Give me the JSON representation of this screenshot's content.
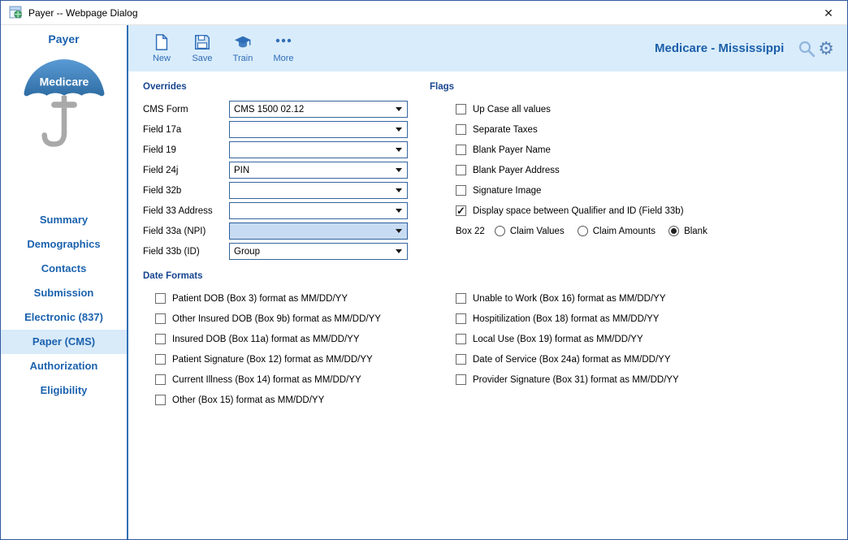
{
  "window": {
    "title": "Payer -- Webpage Dialog",
    "close_glyph": "✕"
  },
  "sidebar": {
    "title": "Payer",
    "logo_text": "Medicare",
    "items": [
      {
        "label": "Summary",
        "active": false
      },
      {
        "label": "Demographics",
        "active": false
      },
      {
        "label": "Contacts",
        "active": false
      },
      {
        "label": "Submission",
        "active": false
      },
      {
        "label": "Electronic (837)",
        "active": false
      },
      {
        "label": "Paper (CMS)",
        "active": true
      },
      {
        "label": "Authorization",
        "active": false
      },
      {
        "label": "Eligibility",
        "active": false
      }
    ]
  },
  "toolbar": {
    "buttons": [
      {
        "label": "New"
      },
      {
        "label": "Save"
      },
      {
        "label": "Train"
      },
      {
        "label": "More"
      }
    ],
    "context_title": "Medicare - Mississippi"
  },
  "sections": {
    "overrides": {
      "heading": "Overrides",
      "fields": [
        {
          "label": "CMS Form",
          "value": "CMS 1500 02.12",
          "focused": false
        },
        {
          "label": "Field 17a",
          "value": "",
          "focused": false
        },
        {
          "label": "Field 19",
          "value": "",
          "focused": false
        },
        {
          "label": "Field 24j",
          "value": "PIN",
          "focused": false
        },
        {
          "label": "Field 32b",
          "value": "",
          "focused": false
        },
        {
          "label": "Field 33 Address",
          "value": "",
          "focused": false
        },
        {
          "label": "Field 33a (NPI)",
          "value": "",
          "focused": true
        },
        {
          "label": "Field 33b (ID)",
          "value": "Group",
          "focused": false
        }
      ]
    },
    "flags": {
      "heading": "Flags",
      "checkboxes": [
        {
          "label": "Up Case all values",
          "checked": false
        },
        {
          "label": "Separate Taxes",
          "checked": false
        },
        {
          "label": "Blank Payer Name",
          "checked": false
        },
        {
          "label": "Blank Payer Address",
          "checked": false
        },
        {
          "label": "Signature Image",
          "checked": false
        },
        {
          "label": "Display space between Qualifier and ID (Field 33b)",
          "checked": true
        }
      ],
      "box22": {
        "label": "Box 22",
        "options": [
          {
            "label": "Claim Values",
            "selected": false
          },
          {
            "label": "Claim Amounts",
            "selected": false
          },
          {
            "label": "Blank",
            "selected": true
          }
        ]
      }
    },
    "date_formats": {
      "heading": "Date Formats",
      "left": [
        {
          "label": "Patient DOB (Box 3) format as MM/DD/YY",
          "checked": false
        },
        {
          "label": "Other Insured DOB (Box 9b) format as MM/DD/YY",
          "checked": false
        },
        {
          "label": "Insured DOB (Box 11a) format as MM/DD/YY",
          "checked": false
        },
        {
          "label": "Patient Signature (Box 12) format as MM/DD/YY",
          "checked": false
        },
        {
          "label": "Current Illness (Box 14) format as MM/DD/YY",
          "checked": false
        },
        {
          "label": "Other (Box 15) format as MM/DD/YY",
          "checked": false
        }
      ],
      "right": [
        {
          "label": "Unable to Work (Box 16) format as MM/DD/YY",
          "checked": false
        },
        {
          "label": "Hospitilization (Box 18) format as MM/DD/YY",
          "checked": false
        },
        {
          "label": "Local Use (Box 19) format as MM/DD/YY",
          "checked": false
        },
        {
          "label": "Date of Service (Box 24a) format as MM/DD/YY",
          "checked": false
        },
        {
          "label": "Provider Signature (Box 31) format as MM/DD/YY",
          "checked": false
        }
      ]
    }
  }
}
